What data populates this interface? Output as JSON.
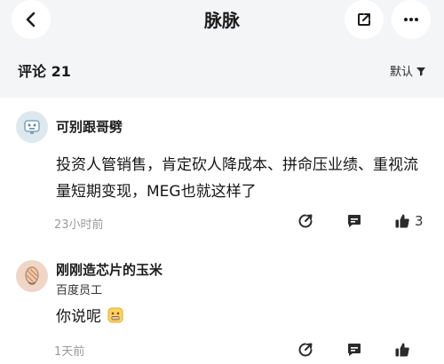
{
  "header": {
    "title": "脉脉"
  },
  "comments_header": {
    "label": "评论 21",
    "sort_label": "默认"
  },
  "comments": [
    {
      "username": "可别跟哥劈",
      "text": "投资人管销售，肯定砍人降成本、拼命压业绩、重视流量短期变现，MEG也就这样了",
      "time": "23小时前",
      "like_count": "3"
    },
    {
      "username": "刚刚造芯片的玉米",
      "subtitle": "百度员工",
      "text": "你说呢",
      "time": "1天前",
      "like_count": ""
    }
  ],
  "icons": {
    "back": "chevron-left-icon",
    "share": "share-out-icon",
    "more": "more-dots-icon",
    "sort": "sort-filter-icon",
    "repost": "repost-icon",
    "reply": "reply-bubble-icon",
    "like": "thumbs-up-icon",
    "emoji": "grimace-emoji-icon"
  },
  "colors": {
    "background": "#f4f5f7",
    "card": "#ffffff",
    "muted_text": "#9a9a9a",
    "icon": "#2b2b2b"
  }
}
